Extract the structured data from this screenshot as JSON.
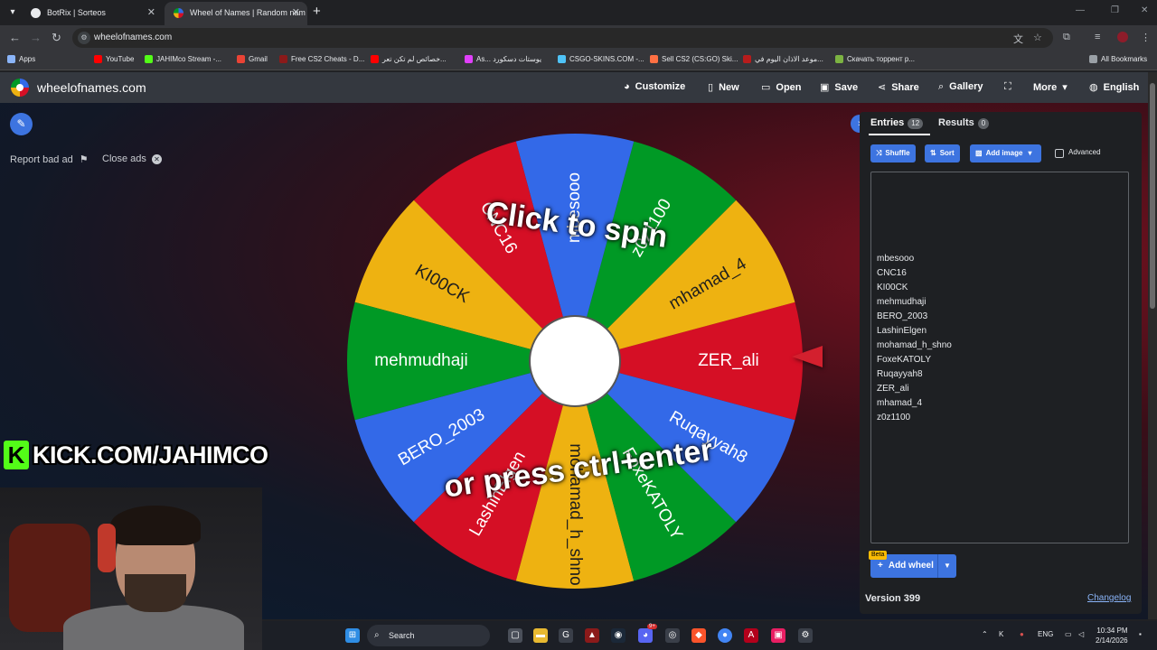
{
  "browser": {
    "tabs": [
      {
        "title": "BotRix | Sorteos",
        "active": false,
        "favicon_color": "#e8eaed"
      },
      {
        "title": "Wheel of Names | Random nam",
        "active": true,
        "favicon_color": "#3369e8"
      }
    ],
    "url": "wheelofnames.com",
    "bookmarks": [
      {
        "label": "Apps",
        "color": "#8ab4f8"
      },
      {
        "label": "YouTube",
        "color": "#ff0000"
      },
      {
        "label": "JAHIMco Stream -...",
        "color": "#53fc18"
      },
      {
        "label": "Gmail",
        "color": "#ea4335"
      },
      {
        "label": "Free CS2 Cheats - D...",
        "color": "#8b1a1a"
      },
      {
        "label": "خصائص لم تكن تعر...",
        "color": "#ff0000"
      },
      {
        "label": "As... يوستات دسكورد",
        "color": "#e040fb"
      },
      {
        "label": "CSGO-SKINS.COM -...",
        "color": "#4fc3f7"
      },
      {
        "label": "Sell CS2 (CS:GO) Ski...",
        "color": "#ff7043"
      },
      {
        "label": "موعد الاذان اليوم في...",
        "color": "#b71c1c"
      },
      {
        "label": "Скачать торрент р...",
        "color": "#7cb342"
      },
      {
        "label": "All Bookmarks",
        "color": "#9aa0a6"
      }
    ]
  },
  "site": {
    "title": "wheelofnames.com",
    "nav": [
      {
        "label": "Customize",
        "icon": "palette-icon",
        "glyph": "◕"
      },
      {
        "label": "New",
        "icon": "new-file-icon",
        "glyph": "▯"
      },
      {
        "label": "Open",
        "icon": "folder-icon",
        "glyph": "▭"
      },
      {
        "label": "Save",
        "icon": "save-icon",
        "glyph": "▣"
      },
      {
        "label": "Share",
        "icon": "share-icon",
        "glyph": "⋖"
      },
      {
        "label": "Gallery",
        "icon": "search-icon",
        "glyph": "⌕"
      },
      {
        "label": "",
        "icon": "fullscreen-icon",
        "glyph": "⛶"
      },
      {
        "label": "More",
        "icon": "chevron-down-icon",
        "glyph": "▾"
      },
      {
        "label": "English",
        "icon": "globe-icon",
        "glyph": "◍"
      }
    ]
  },
  "ads": {
    "report": "Report bad ad",
    "close": "Close ads"
  },
  "wheel": {
    "colors": [
      "#3369e8",
      "#009925",
      "#eeb211",
      "#d50f25"
    ],
    "segments": [
      "ZER_ali",
      "mhamad_4",
      "z0z1100",
      "mbesooo",
      "CNC16",
      "KI00CK",
      "mehmudhaji",
      "BERO_2003",
      "LashinElgen",
      "mohamad_h_shno",
      "FoxeKATOLY",
      "Ruqayyah8"
    ],
    "segment_colors": [
      "#d50f25",
      "#eeb211",
      "#009925",
      "#3369e8",
      "#d50f25",
      "#eeb211",
      "#009925",
      "#3369e8",
      "#d50f25",
      "#eeb211",
      "#009925",
      "#3369e8"
    ],
    "prompt_top": "Click to spin",
    "prompt_bottom": "or press ctrl+enter"
  },
  "overlay": {
    "kick_text": "KICK.COM/JAHIMCO",
    "kick_letter": "K"
  },
  "panel": {
    "tabs": [
      {
        "label": "Entries",
        "count": "12"
      },
      {
        "label": "Results",
        "count": "0"
      }
    ],
    "buttons": {
      "shuffle": "Shuffle",
      "sort": "Sort",
      "add_image": "Add image",
      "advanced": "Advanced"
    },
    "entries": [
      "mbesooo",
      "CNC16",
      "KI00CK",
      "mehmudhaji",
      "BERO_2003",
      "LashinElgen",
      "mohamad_h_shno",
      "FoxeKATOLY",
      "Ruqayyah8",
      "ZER_ali",
      "mhamad_4",
      "z0z1100"
    ],
    "beta": "Beta",
    "add_wheel": "Add wheel",
    "version": "Version 399",
    "changelog": "Changelog"
  },
  "taskbar": {
    "search": "Search",
    "language": "ENG",
    "time": "10:34 PM",
    "date": "2/14/2026",
    "notification_badge": "9+"
  }
}
